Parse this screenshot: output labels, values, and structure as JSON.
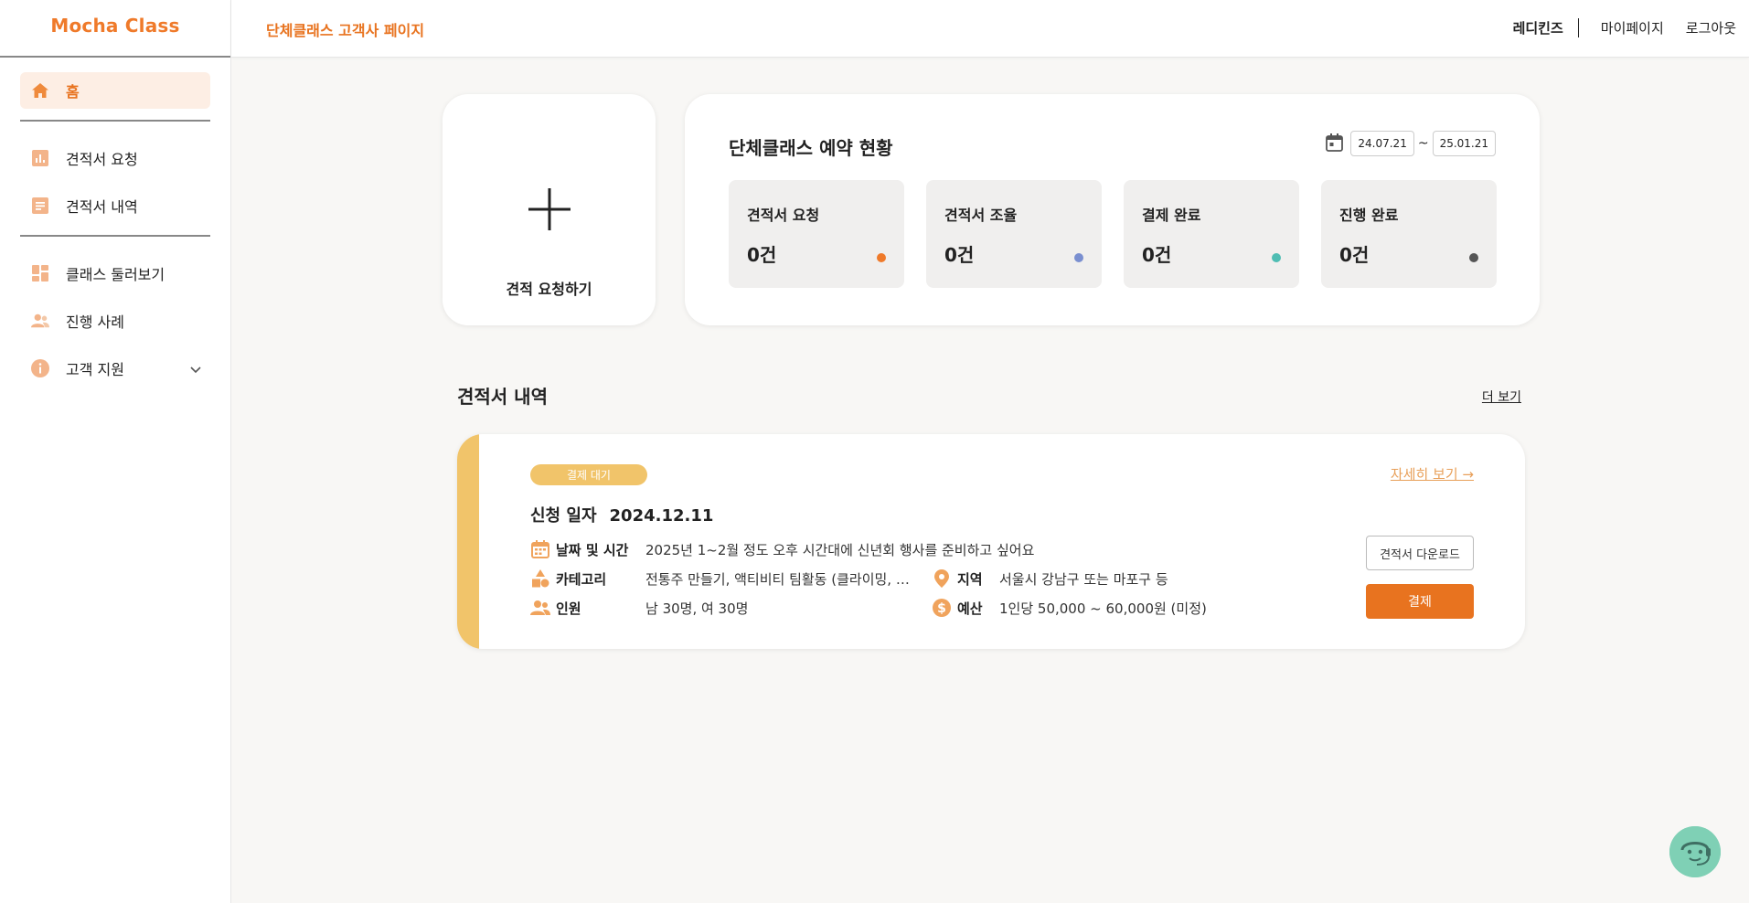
{
  "app": {
    "logo": "Mocha Class",
    "page_title": "단체클래스 고객사 페이지"
  },
  "colors": {
    "accent": "#e8731f",
    "accent_light": "#fdeee4",
    "badge_yellow": "#f1c46a",
    "dot_orange": "#ef7a2a",
    "dot_blue": "#7a8fd0",
    "dot_teal": "#4fbdb3",
    "dot_dark": "#555555"
  },
  "header": {
    "user": "레디킨즈",
    "links": [
      "마이페이지",
      "로그아웃"
    ]
  },
  "sidebar": {
    "items": [
      {
        "label": "홈",
        "icon": "home-icon",
        "active": true
      },
      {
        "label": "견적서 요청",
        "icon": "bar-chart-icon"
      },
      {
        "label": "견적서 내역",
        "icon": "document-icon"
      },
      {
        "label": "클래스 둘러보기",
        "icon": "dashboard-icon"
      },
      {
        "label": "진행 사례",
        "icon": "people-icon"
      },
      {
        "label": "고객 지원",
        "icon": "info-icon",
        "expandable": true
      }
    ]
  },
  "request_card": {
    "label": "견적 요청하기"
  },
  "status": {
    "title": "단체클래스 예약 현황",
    "date_from": "24.07.21",
    "date_sep": "~",
    "date_to": "25.01.21",
    "tiles": [
      {
        "label": "견적서 요청",
        "count": "0건"
      },
      {
        "label": "견적서 조율",
        "count": "0건"
      },
      {
        "label": "결제 완료",
        "count": "0건"
      },
      {
        "label": "진행 완료",
        "count": "0건"
      }
    ]
  },
  "quotes": {
    "title": "견적서 내역",
    "more": "더 보기",
    "item": {
      "badge": "결제 대기",
      "detail_link": "자세히 보기 →",
      "apply_label": "신청 일자",
      "apply_date": "2024.12.11",
      "date_time_label": "날짜 및 시간",
      "date_time": "2025년 1~2월 정도 오후 시간대에 신년회 행사를 준비하고 싶어요",
      "category_label": "카테고리",
      "category": "전통주 만들기, 액티비티 팀활동 (클라이밍, 볼링 등)",
      "region_label": "지역",
      "region": "서울시 강남구 또는 마포구 등",
      "people_label": "인원",
      "people": "남 30명, 여 30명",
      "budget_label": "예산",
      "budget": "1인당 50,000 ~ 60,000원 (미정)",
      "download_label": "견적서 다운로드",
      "pay_label": "결제"
    }
  }
}
